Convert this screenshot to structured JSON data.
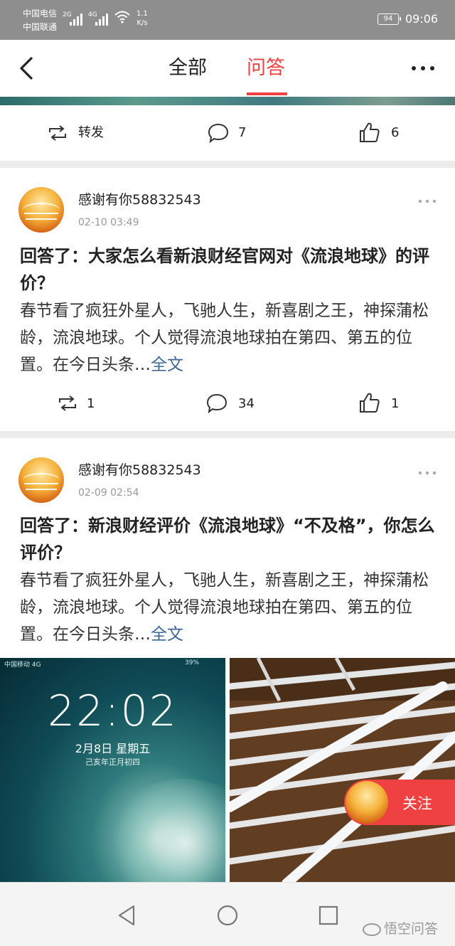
{
  "status_bar": {
    "carrier1": "中国电信",
    "carrier2": "中国联通",
    "net1": "2G",
    "net2": "4G",
    "speed_value": "1.1",
    "speed_unit": "K/s",
    "battery": "94",
    "time": "09:06"
  },
  "nav": {
    "tab_all": "全部",
    "tab_qa": "问答",
    "active_tab": "问答",
    "accent_color": "#f04142"
  },
  "prev_card": {
    "repost_label": "转发",
    "comments": "7",
    "likes": "6"
  },
  "posts": [
    {
      "username": "感谢有你58832543",
      "time": "02-10 03:49",
      "title": "回答了：大家怎么看新浪财经官网对《流浪地球》的评价？",
      "excerpt": "春节看了疯狂外星人，飞驰人生，新喜剧之王，神探蒲松龄，流浪地球。个人觉得流浪地球拍在第四、第五的位置。在今日头条…",
      "more_link": "全文",
      "reposts": "1",
      "comments": "34",
      "likes": "1"
    },
    {
      "username": "感谢有你58832543",
      "time": "02-09 02:54",
      "title": "回答了：新浪财经评价《流浪地球》“不及格”，你怎么评价？",
      "excerpt": "春节看了疯狂外星人，飞驰人生，新喜剧之王，神探蒲松龄，流浪地球。个人觉得流浪地球拍在第四、第五的位置。在今日头条…",
      "more_link": "全文",
      "photo_left": {
        "status_text": "中国移动  4G",
        "battery_text": "39%",
        "clock": "22:02",
        "date": "2月8日 星期五",
        "lunar": "己亥年正月初四"
      }
    }
  ],
  "follow_button": {
    "label": "关注"
  },
  "watermark": "悟空问答"
}
